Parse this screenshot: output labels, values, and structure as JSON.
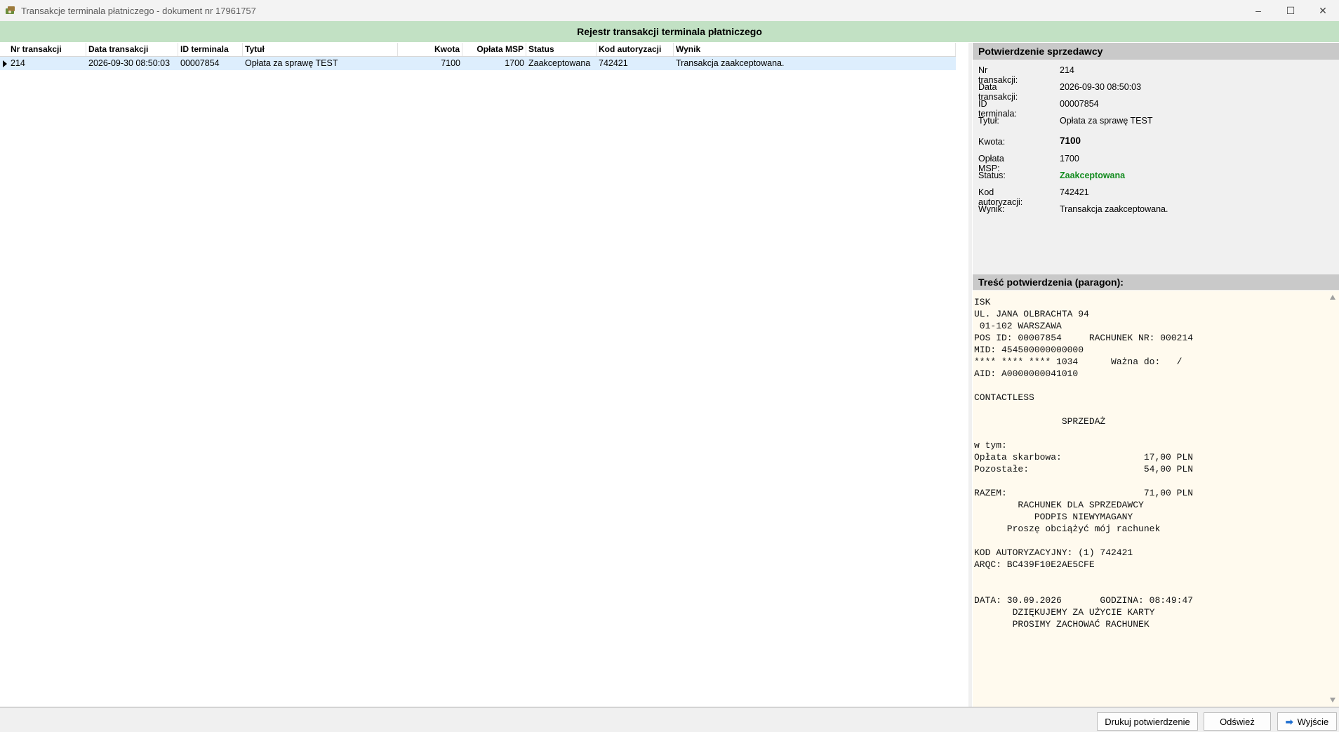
{
  "window": {
    "title": "Transakcje terminala płatniczego - dokument nr 17961757",
    "minimize": "–",
    "maximize": "☐",
    "close": "✕"
  },
  "banner": "Rejestr transakcji terminala płatniczego",
  "table": {
    "columns": [
      "Nr transakcji",
      "Data transakcji",
      "ID terminala",
      "Tytuł",
      "Kwota",
      "Opłata MSP",
      "Status",
      "Kod autoryzacji",
      "Wynik"
    ],
    "rows": [
      [
        "214",
        "2026-09-30 08:50:03",
        "00007854",
        "Opłata za sprawę TEST",
        "7100",
        "1700",
        "Zaakceptowana",
        "742421",
        "Transakcja zaakceptowana."
      ]
    ]
  },
  "confirmation": {
    "header": "Potwierdzenie sprzedawcy",
    "fields": [
      {
        "label": "Nr transakcji:",
        "value": "214"
      },
      {
        "label": "Data transakcji:",
        "value": "2026-09-30 08:50:03"
      },
      {
        "label": "ID terminala:",
        "value": "00007854"
      },
      {
        "label": "Tytuł:",
        "value": "Opłata za sprawę TEST"
      },
      {
        "label": "Kwota:",
        "value": "7100"
      },
      {
        "label": "Opłata MSP:",
        "value": "1700"
      },
      {
        "label": "Status:",
        "value": "Zaakceptowana"
      },
      {
        "label": "Kod autoryzacji:",
        "value": "742421"
      },
      {
        "label": "Wynik:",
        "value": "Transakcja zaakceptowana."
      }
    ]
  },
  "receipt": {
    "header": "Treść potwierdzenia (paragon):",
    "text": "ISK\nUL. JANA OLBRACHTA 94\n 01-102 WARSZAWA\nPOS ID: 00007854     RACHUNEK NR: 000214\nMID: 454500000000000\n**** **** **** 1034      Ważna do:   /\nAID: A0000000041010\n\nCONTACTLESS\n\n                SPRZEDAŻ\n\nw tym:\nOpłata skarbowa:               17,00 PLN\nPozostałe:                     54,00 PLN\n\nRAZEM:                         71,00 PLN\n        RACHUNEK DLA SPRZEDAWCY\n           PODPIS NIEWYMAGANY\n      Proszę obciążyć mój rachunek\n\nKOD AUTORYZACYJNY: (1) 742421\nARQC: BC439F10E2AE5CFE\n\n\nDATA: 30.09.2026       GODZINA: 08:49:47\n       DZIĘKUJEMY ZA UŻYCIE KARTY\n       PROSIMY ZACHOWAĆ RACHUNEK"
  },
  "buttons": {
    "print": "Drukuj potwierdzenie",
    "refresh": "Odśwież",
    "exit": "Wyjście"
  },
  "colors": {
    "banner": "#c2e1c4",
    "selected_row": "#ddeefd",
    "status_accepted": "#128b1e",
    "receipt_bg": "#fffaee"
  }
}
